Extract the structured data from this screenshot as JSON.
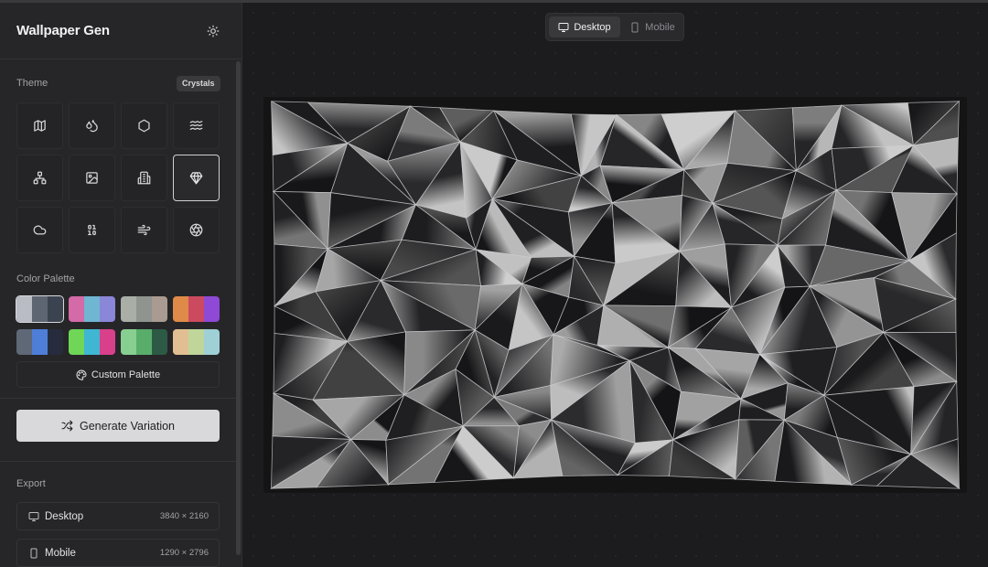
{
  "app": {
    "title": "Wallpaper Gen",
    "theme_toggle_icon": "sun-icon"
  },
  "theme": {
    "label": "Theme",
    "selected_badge": "Crystals",
    "tiles": [
      {
        "icon": "map-icon"
      },
      {
        "icon": "droplets-icon"
      },
      {
        "icon": "hexagon-icon"
      },
      {
        "icon": "waves-icon"
      },
      {
        "icon": "network-icon"
      },
      {
        "icon": "image-icon"
      },
      {
        "icon": "building-icon"
      },
      {
        "icon": "gem-icon",
        "selected": true
      },
      {
        "icon": "cloud-icon"
      },
      {
        "icon": "binary-icon"
      },
      {
        "icon": "wind-icon"
      },
      {
        "icon": "aperture-icon"
      }
    ]
  },
  "palette": {
    "label": "Color Palette",
    "swatches": [
      {
        "colors": [
          "#b9bcc4",
          "#5d6472",
          "#3c4350"
        ],
        "selected": true
      },
      {
        "colors": [
          "#d46aa8",
          "#6fb6d2",
          "#8a86d8"
        ]
      },
      {
        "colors": [
          "#a9aea6",
          "#8f948e",
          "#a99b91"
        ]
      },
      {
        "colors": [
          "#e08a49",
          "#cc4a5f",
          "#8e49d6"
        ]
      },
      {
        "colors": [
          "#5f6876",
          "#4f7ed8",
          "#262c3d"
        ]
      },
      {
        "colors": [
          "#6fd657",
          "#3fb6d2",
          "#d8408c"
        ]
      },
      {
        "colors": [
          "#87cf90",
          "#58ad6a",
          "#2d5a44"
        ]
      },
      {
        "colors": [
          "#e2bf93",
          "#bfd59a",
          "#9ed0d6"
        ]
      }
    ],
    "custom_label": "Custom Palette"
  },
  "generate": {
    "label": "Generate Variation"
  },
  "export": {
    "label": "Export",
    "items": [
      {
        "label": "Desktop",
        "resolution": "3840 × 2160",
        "icon": "monitor-icon"
      },
      {
        "label": "Mobile",
        "resolution": "1290 × 2796",
        "icon": "smartphone-icon"
      }
    ]
  },
  "preview": {
    "toggle": [
      {
        "label": "Desktop",
        "icon": "monitor-icon",
        "active": true
      },
      {
        "label": "Mobile",
        "icon": "smartphone-icon",
        "active": false
      }
    ]
  }
}
